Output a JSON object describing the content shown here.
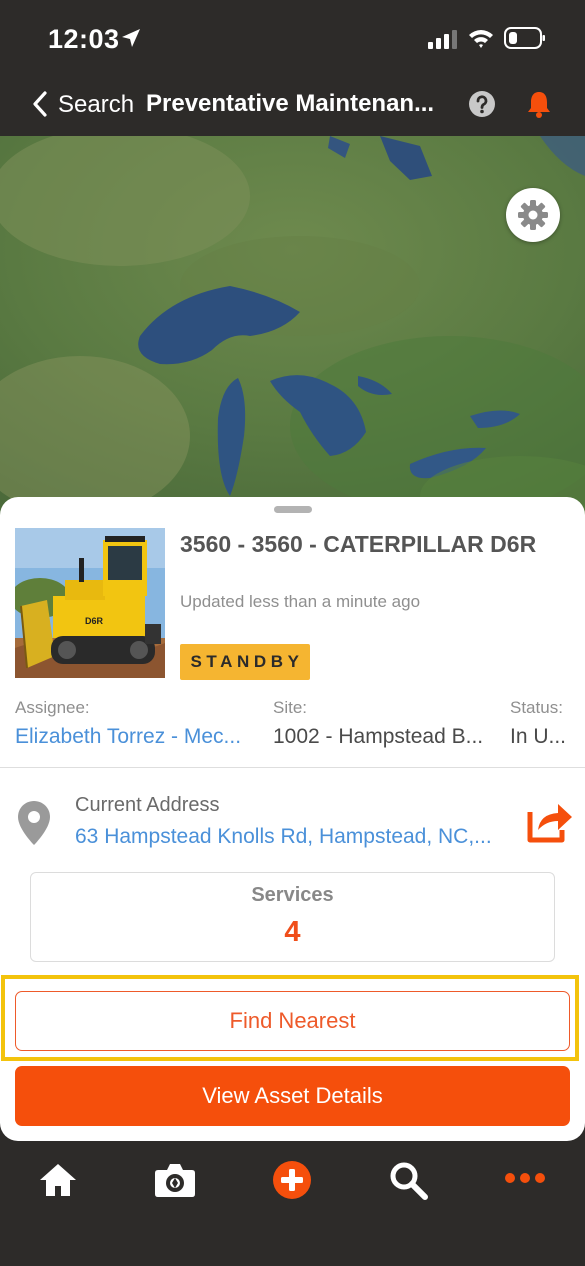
{
  "status_bar": {
    "time": "12:03"
  },
  "nav": {
    "back_label": "Search",
    "title": "Preventative Maintenan..."
  },
  "asset": {
    "title": "3560 - 3560 - CATERPILLAR D6R",
    "updated": "Updated less than a minute ago",
    "status_badge": "STANDBY",
    "status_badge_color": "#f5b531"
  },
  "fields": {
    "assignee_label": "Assignee:",
    "assignee_value": "Elizabeth Torrez - Mec...",
    "site_label": "Site:",
    "site_value": "1002 - Hampstead B...",
    "status_label": "Status:",
    "status_value": "In U..."
  },
  "address": {
    "label": "Current Address",
    "value": "63 Hampstead Knolls Rd, Hampstead, NC,..."
  },
  "services": {
    "label": "Services",
    "count": "4"
  },
  "buttons": {
    "find_nearest": "Find Nearest",
    "view_asset_details": "View Asset Details"
  },
  "colors": {
    "accent": "#f54f0c",
    "highlight": "#f3c30c",
    "link": "#4a90d9",
    "bar_background": "#2d2b29"
  },
  "tabs": [
    {
      "icon": "home-icon"
    },
    {
      "icon": "camera-icon"
    },
    {
      "icon": "add-icon"
    },
    {
      "icon": "search-icon"
    },
    {
      "icon": "more-icon"
    }
  ]
}
